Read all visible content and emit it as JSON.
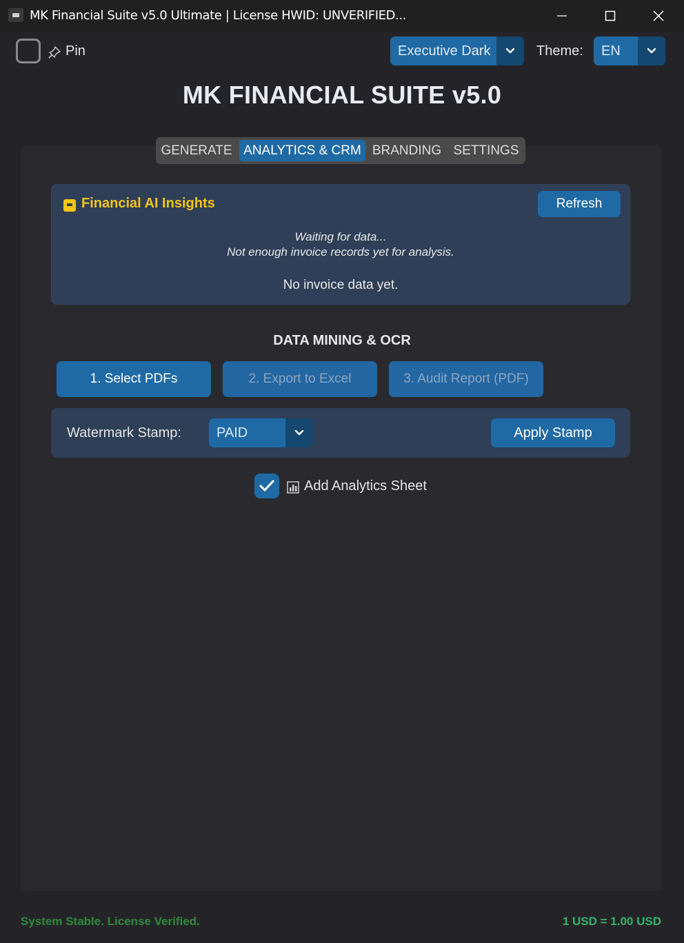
{
  "window": {
    "title": "MK Financial Suite v5.0 Ultimate | License HWID: UNVERIFIED..."
  },
  "toolbar": {
    "pin_label": "Pin",
    "pin_checked": false,
    "theme_select_value": "Executive Dark",
    "theme_label": "Theme:",
    "language_select_value": "EN"
  },
  "app": {
    "title": "MK FINANCIAL SUITE v5.0"
  },
  "tabs": [
    {
      "label": "GENERATE",
      "active": false
    },
    {
      "label": "ANALYTICS & CRM",
      "active": true
    },
    {
      "label": "BRANDING",
      "active": false
    },
    {
      "label": "SETTINGS",
      "active": false
    }
  ],
  "insights": {
    "title": "Financial AI Insights",
    "refresh_label": "Refresh",
    "message_line1": "Waiting for data...",
    "message_line2": "Not enough invoice records yet for analysis.",
    "no_data": "No invoice data yet."
  },
  "data_mining": {
    "heading": "DATA MINING & OCR",
    "buttons": [
      {
        "label": "1. Select PDFs",
        "enabled": true
      },
      {
        "label": "2. Export to Excel",
        "enabled": false
      },
      {
        "label": "3. Audit Report (PDF)",
        "enabled": false
      }
    ]
  },
  "watermark": {
    "label": "Watermark Stamp:",
    "value": "PAID",
    "apply_label": "Apply Stamp"
  },
  "analytics_sheet": {
    "label": "Add Analytics Sheet",
    "checked": true
  },
  "status": {
    "left": "System Stable. License Verified.",
    "right": "1 USD = 1.00 USD"
  },
  "colors": {
    "accent": "#1f6aa5",
    "panel": "#2e3f57",
    "insight_title": "#f5c518",
    "status_ok": "#2e8b3a",
    "rate": "#36b36a"
  }
}
